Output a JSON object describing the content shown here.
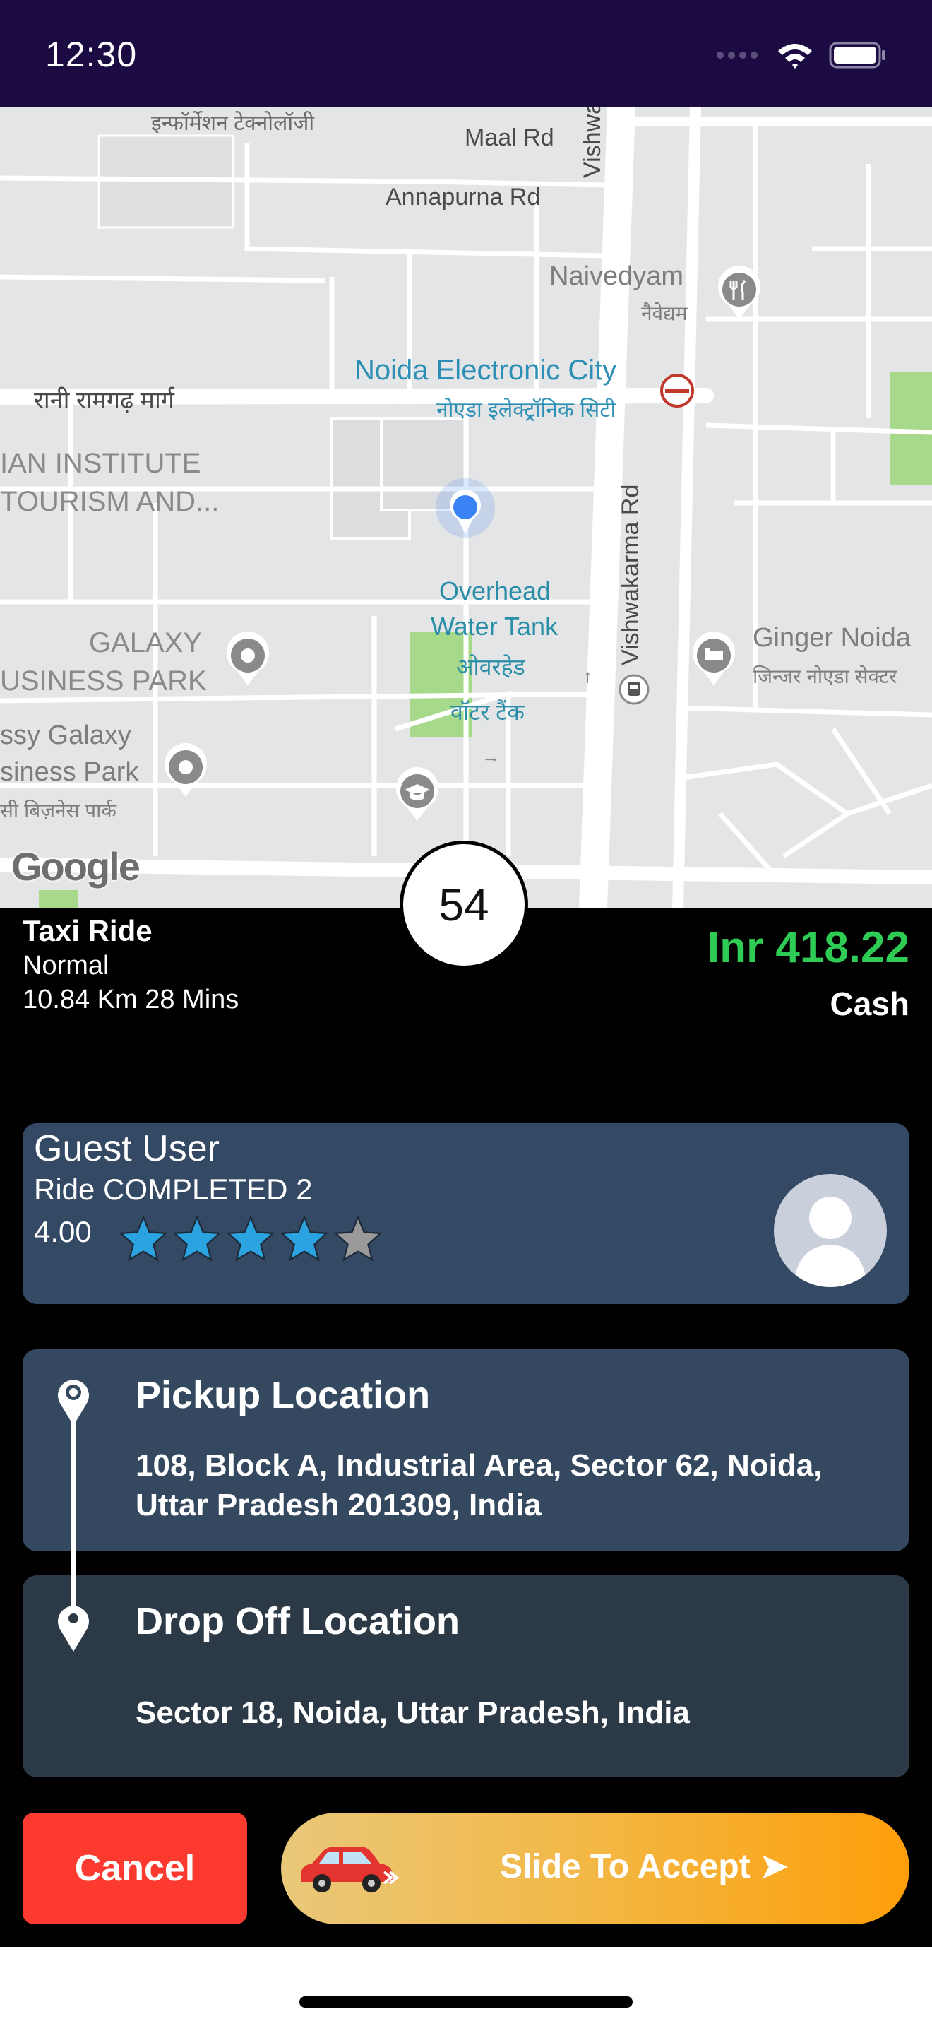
{
  "status_bar": {
    "time": "12:30"
  },
  "map": {
    "attribution": "Google",
    "labels": {
      "information_tech": "इन्फॉर्मेशन टेक्नोलॉजी",
      "maal_rd": "Maal Rd",
      "annapurna_rd": "Annapurna Rd",
      "vishwakarma_top": "Vishwakar",
      "naivedyam": "Naivedyam",
      "naivedyam_hi": "नैवेद्यम",
      "rani_ramgarh": "रानी रामगढ़ मार्ग",
      "noida_electronic_city": "Noida Electronic City",
      "noida_electronic_city_hi": "नोएडा इलेक्ट्रॉनिक सिटी",
      "institute_line1": "IAN INSTITUTE",
      "institute_line2": "TOURISM AND...",
      "vishwakarma_rd": "Vishwakarma Rd",
      "overhead_line1": "Overhead",
      "overhead_line2": "Water Tank",
      "overhead_hi1": "ओवरहेड",
      "overhead_hi2": "वॉटर टैंक",
      "galaxy_line1": "GALAXY",
      "galaxy_line2": "USINESS PARK",
      "ginger_noida": "Ginger Noida",
      "ginger_noida_hi": "जिन्जर नोएडा सेक्टर",
      "galaxy2_line1": "ssy Galaxy",
      "galaxy2_line2": "siness Park",
      "galaxy2_hi": "सी बिज़नेस पार्क"
    }
  },
  "ride": {
    "eta": "54",
    "type": "Taxi Ride",
    "category": "Normal",
    "distance_time": "10.84 Km 28 Mins",
    "price": "Inr 418.22",
    "payment": "Cash"
  },
  "user": {
    "name": "Guest User",
    "rides": "Ride COMPLETED 2",
    "rating_text": "4.00",
    "rating": 4,
    "rating_max": 5
  },
  "pickup": {
    "title": "Pickup Location",
    "address_line1": "108, Block A, Industrial Area, Sector 62, Noida,",
    "address_line2": "Uttar Pradesh 201309, India"
  },
  "dropoff": {
    "title": "Drop Off Location",
    "address": "Sector 18, Noida, Uttar Pradesh, India"
  },
  "actions": {
    "cancel_label": "Cancel",
    "slide_label": "Slide To Accept ➤"
  },
  "colors": {
    "status_bar_bg": "#1b0b42",
    "price_green": "#2ecc55",
    "user_card_bg": "#344a64",
    "pickup_card_bg": "#34495f",
    "dropoff_card_bg": "#2c3a48",
    "cancel_red": "#fd3a30",
    "star_blue": "#2aa3e0",
    "star_gray": "#9a9a9a"
  }
}
